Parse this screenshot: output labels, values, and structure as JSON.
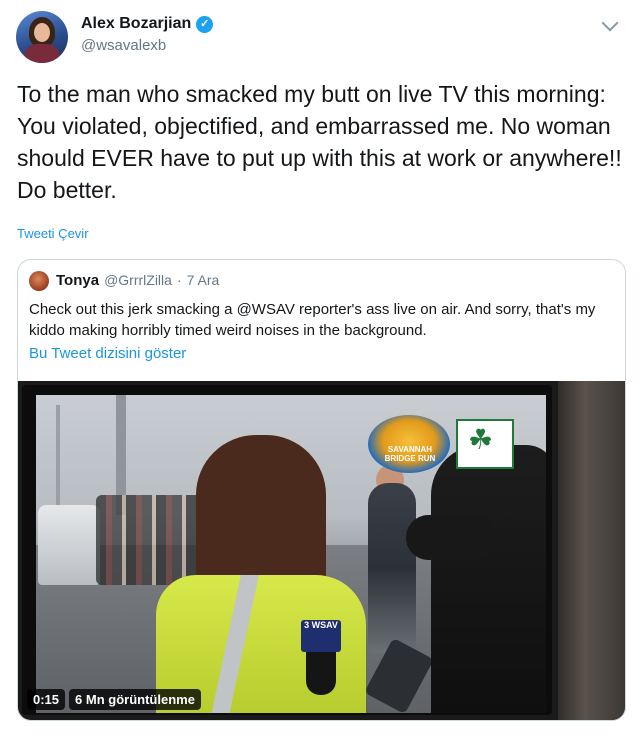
{
  "author": {
    "name": "Alex Bozarjian",
    "handle": "@wsavalexb",
    "verified": true
  },
  "tweet": {
    "text": "To the man who smacked my butt on live TV this morning: You violated, objectified, and embarrassed me. No woman should EVER have to put up with this at work or anywhere!! Do better.",
    "translate_label": "Tweeti Çevir"
  },
  "quote": {
    "name": "Tonya",
    "handle": "@GrrrlZilla",
    "separator": "·",
    "date": "7 Ara",
    "text": "Check out this jerk smacking a @WSAV reporter's ass live on air. And sorry, that's my kiddo making horribly timed weird noises in the background.",
    "thread_label": "Bu Tweet dizisini göster"
  },
  "video": {
    "duration": "0:15",
    "views": "6 Mn görüntülenme",
    "mic_flag": "3 WSAV",
    "logo_text": "SAVANNAH BRIDGE RUN"
  },
  "colors": {
    "accent": "#1b95e0",
    "verified": "#1da1f2",
    "secondary_text": "#657786",
    "border": "#ccd6dd"
  },
  "icons": {
    "verified": "verified-badge-icon",
    "menu": "chevron-down-icon"
  }
}
